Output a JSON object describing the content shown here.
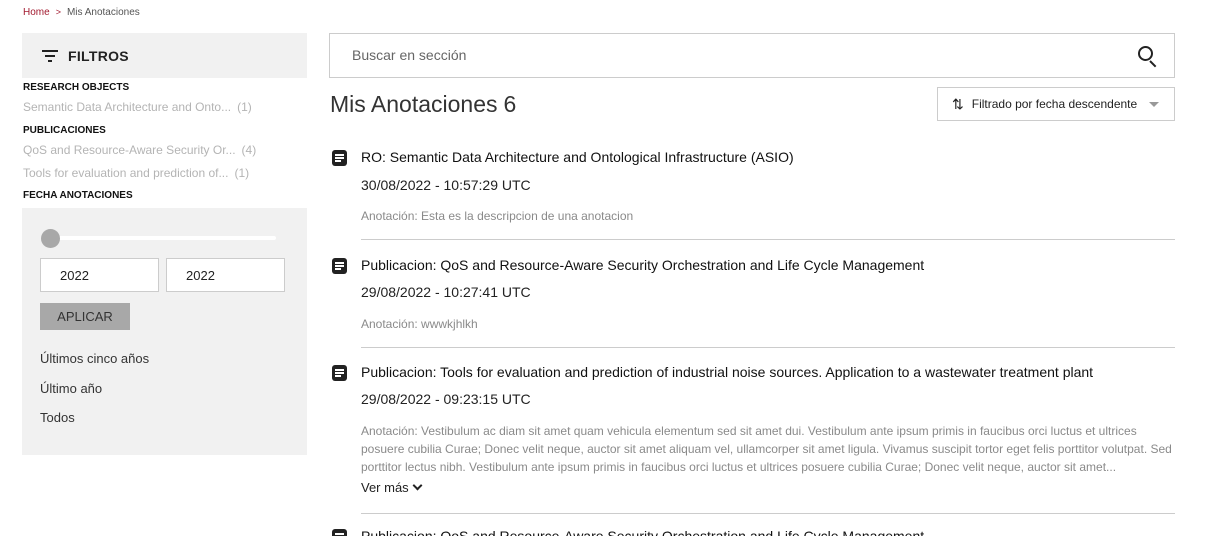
{
  "breadcrumb": {
    "home": "Home",
    "separator": ">",
    "current": "Mis Anotaciones"
  },
  "filters": {
    "title": "FILTROS",
    "research_objects": {
      "title": "RESEARCH OBJECTS",
      "items": [
        {
          "label": "Semantic Data Architecture and Onto...",
          "count": "(1)"
        }
      ]
    },
    "publicaciones": {
      "title": "PUBLICACIONES",
      "items": [
        {
          "label": "QoS and Resource-Aware Security Or...",
          "count": "(4)"
        },
        {
          "label": "Tools for evaluation and prediction of...",
          "count": "(1)"
        }
      ]
    },
    "fecha": {
      "title": "FECHA ANOTACIONES",
      "from": "2022",
      "to": "2022",
      "apply_label": "APLICAR",
      "quick": [
        "Últimos cinco años",
        "Último año",
        "Todos"
      ]
    }
  },
  "search": {
    "placeholder": "Buscar en sección"
  },
  "main": {
    "title": "Mis Anotaciones",
    "count": "6",
    "sort_label": "Filtrado por fecha descendente",
    "results": [
      {
        "title": "RO: Semantic Data Architecture and Ontological Infrastructure (ASIO)",
        "date": "30/08/2022 - 10:57:29 UTC",
        "annotation": "Anotación: Esta es la descripcion de una anotacion"
      },
      {
        "title": "Publicacion: QoS and Resource-Aware Security Orchestration and Life Cycle Management",
        "date": "29/08/2022 - 10:27:41 UTC",
        "annotation": "Anotación: wwwkjhlkh"
      },
      {
        "title": "Publicacion: Tools for evaluation and prediction of industrial noise sources. Application to a wastewater treatment plant",
        "date": "29/08/2022 - 09:23:15 UTC",
        "annotation": "Anotación: Vestibulum ac diam sit amet quam vehicula elementum sed sit amet dui. Vestibulum ante ipsum primis in faucibus orci luctus et ultrices posuere cubilia Curae; Donec velit neque, auctor sit amet aliquam vel, ullamcorper sit amet ligula. Vivamus suscipit tortor eget felis porttitor volutpat. Sed porttitor lectus nibh. Vestibulum ante ipsum primis in faucibus orci luctus et ultrices posuere cubilia Curae; Donec velit neque, auctor sit amet...",
        "see_more": "Ver más"
      },
      {
        "title": "Publicacion: QoS and Resource-Aware Security Orchestration and Life Cycle Management"
      }
    ]
  }
}
